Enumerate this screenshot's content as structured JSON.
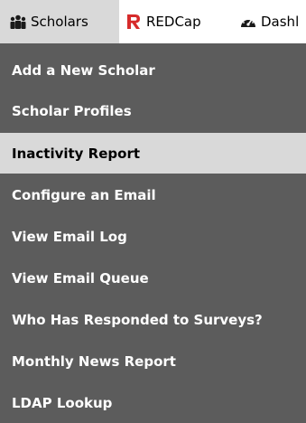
{
  "navbar": {
    "tabs": [
      {
        "label": "Scholars",
        "icon": "people-icon",
        "active": true
      },
      {
        "label": "REDCap",
        "icon": "redcap-logo-icon",
        "active": false
      },
      {
        "label": "Dashl",
        "icon": "dashboard-gauge-icon",
        "active": false
      }
    ]
  },
  "menu": {
    "items": [
      {
        "label": "Add a New Scholar"
      },
      {
        "label": "Scholar Profiles"
      },
      {
        "label": "Inactivity Report",
        "highlighted": true
      },
      {
        "label": "Configure an Email"
      },
      {
        "label": "View Email Log"
      },
      {
        "label": "View Email Queue"
      },
      {
        "label": "Who Has Responded to Surveys?"
      },
      {
        "label": "Monthly News Report"
      },
      {
        "label": "LDAP Lookup"
      }
    ]
  },
  "colors": {
    "menu_background": "#5c5c5c",
    "highlight_background": "#d9d9d9",
    "active_tab_background": "#d9d9d9",
    "redcap_red": "#d62b2b"
  }
}
